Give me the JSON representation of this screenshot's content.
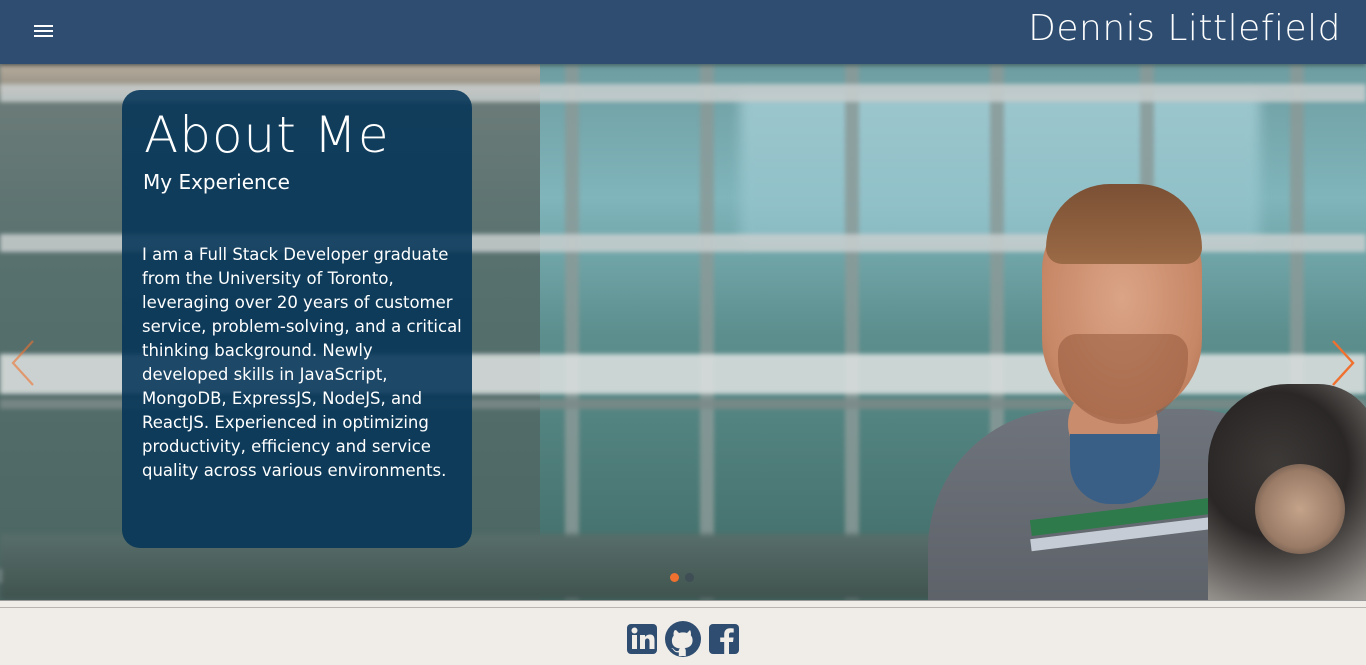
{
  "header": {
    "site_title": "Dennis Littlefield",
    "menu_icon": "hamburger-menu-icon",
    "background_color": "#2e4d70"
  },
  "hero": {
    "card": {
      "title": "About Me",
      "subtitle": "My Experience",
      "body": "I am a Full Stack Developer graduate from the University of Toronto, leveraging over 20 years of customer service, problem-solving, and a critical thinking background. Newly developed skills in JavaScript, MongoDB, ExpressJS, NodeJS, and ReactJS. Experienced in optimizing productivity, efficiency and service quality across various environments.",
      "background_color": "#04345a"
    },
    "prev_icon": "chevron-left-icon",
    "next_icon": "chevron-right-icon",
    "arrow_color": "#f0712f",
    "indicators": {
      "count": 2,
      "active_index": 0,
      "active_color": "#f0712f",
      "inactive_color": "#3f4e55"
    }
  },
  "footer": {
    "social_links": [
      {
        "icon": "linkedin-icon"
      },
      {
        "icon": "github-icon"
      },
      {
        "icon": "facebook-icon"
      }
    ],
    "icon_color": "#2e4d70",
    "background_color": "#f0ece8"
  }
}
